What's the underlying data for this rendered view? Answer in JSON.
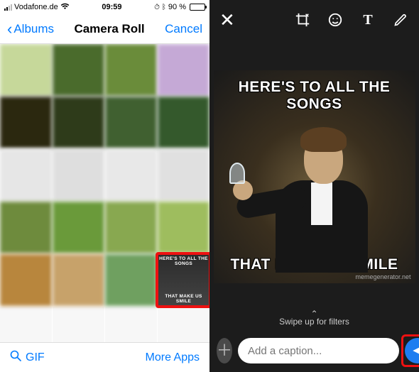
{
  "status": {
    "carrier": "Vodafone.de",
    "time": "09:59",
    "alarm_icon": "⏰",
    "bluetooth_icon": "ᛒ",
    "battery_pct": "90 %"
  },
  "nav": {
    "back_label": "Albums",
    "title": "Camera Roll",
    "cancel_label": "Cancel"
  },
  "footer": {
    "gif_label": "GIF",
    "more_apps_label": "More Apps"
  },
  "meme": {
    "top": "HERE'S TO ALL THE SONGS",
    "bottom": "THAT MAKE US SMILE",
    "watermark": "memegenerator.net"
  },
  "editor": {
    "swipe_hint": "Swipe up for filters",
    "caption_placeholder": "Add a caption..."
  }
}
